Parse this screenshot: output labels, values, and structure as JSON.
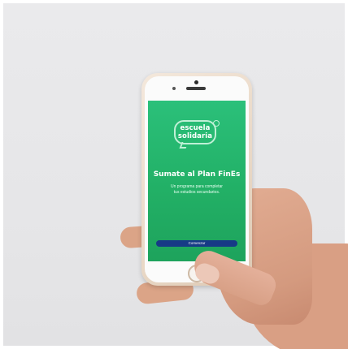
{
  "app": {
    "logo_line1": "escuela",
    "logo_line2": "solidaria",
    "headline": "Sumate al Plan FinEs",
    "subtitle_line1": "Un programa para completar",
    "subtitle_line2": "tus estudios secundarios.",
    "cta_label": "Comenzar"
  },
  "colors": {
    "screen_green": "#22b066",
    "button_navy": "#173a86",
    "logo_outline": "#bff0d6"
  },
  "icons": {
    "logo": "speech-bubble-logo"
  }
}
